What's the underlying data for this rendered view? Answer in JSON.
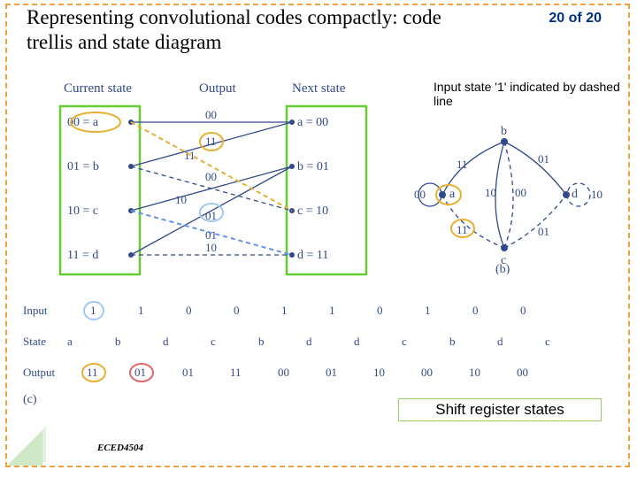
{
  "title": "Representing convolutional codes compactly: code trellis and state diagram",
  "page": "20 of 20",
  "note": "Input state '1' indicated by dashed line",
  "shiftreg": "Shift register states",
  "course": "ECED4504",
  "trellis": {
    "headers": {
      "cur": "Current state",
      "out": "Output",
      "next": "Next state"
    },
    "states": {
      "a": {
        "cur": "00 = a",
        "next": "a = 00"
      },
      "b": {
        "cur": "01 = b",
        "next": "b = 01"
      },
      "c": {
        "cur": "10 = c",
        "next": "c = 10"
      },
      "d": {
        "cur": "11 = d",
        "next": "d = 11"
      }
    },
    "outputs": {
      "aa": "00",
      "ac": "11",
      "ba": "11",
      "bc": "00",
      "cb": "10",
      "cd": "01",
      "db": "01",
      "dd": "10"
    }
  },
  "sequence": {
    "labels": {
      "input": "Input",
      "state": "State",
      "output": "Output"
    },
    "input": [
      "1",
      "1",
      "0",
      "0",
      "1",
      "1",
      "0",
      "1",
      "0",
      "0"
    ],
    "state": [
      "a",
      "b",
      "d",
      "c",
      "b",
      "d",
      "d",
      "c",
      "b",
      "d",
      "c"
    ],
    "output": [
      "11",
      "01",
      "01",
      "11",
      "00",
      "01",
      "10",
      "00",
      "10",
      "00"
    ],
    "partLabel": "(c)"
  },
  "statediag": {
    "nodes": {
      "a": "a",
      "b": "b",
      "c": "c",
      "d": "d"
    },
    "edges": {
      "aa": "00",
      "ac": "11",
      "bc": "00",
      "ba": "11",
      "cb": "10",
      "cd": "01",
      "db": "01",
      "dd": "10"
    },
    "partLabel": "(b)"
  }
}
